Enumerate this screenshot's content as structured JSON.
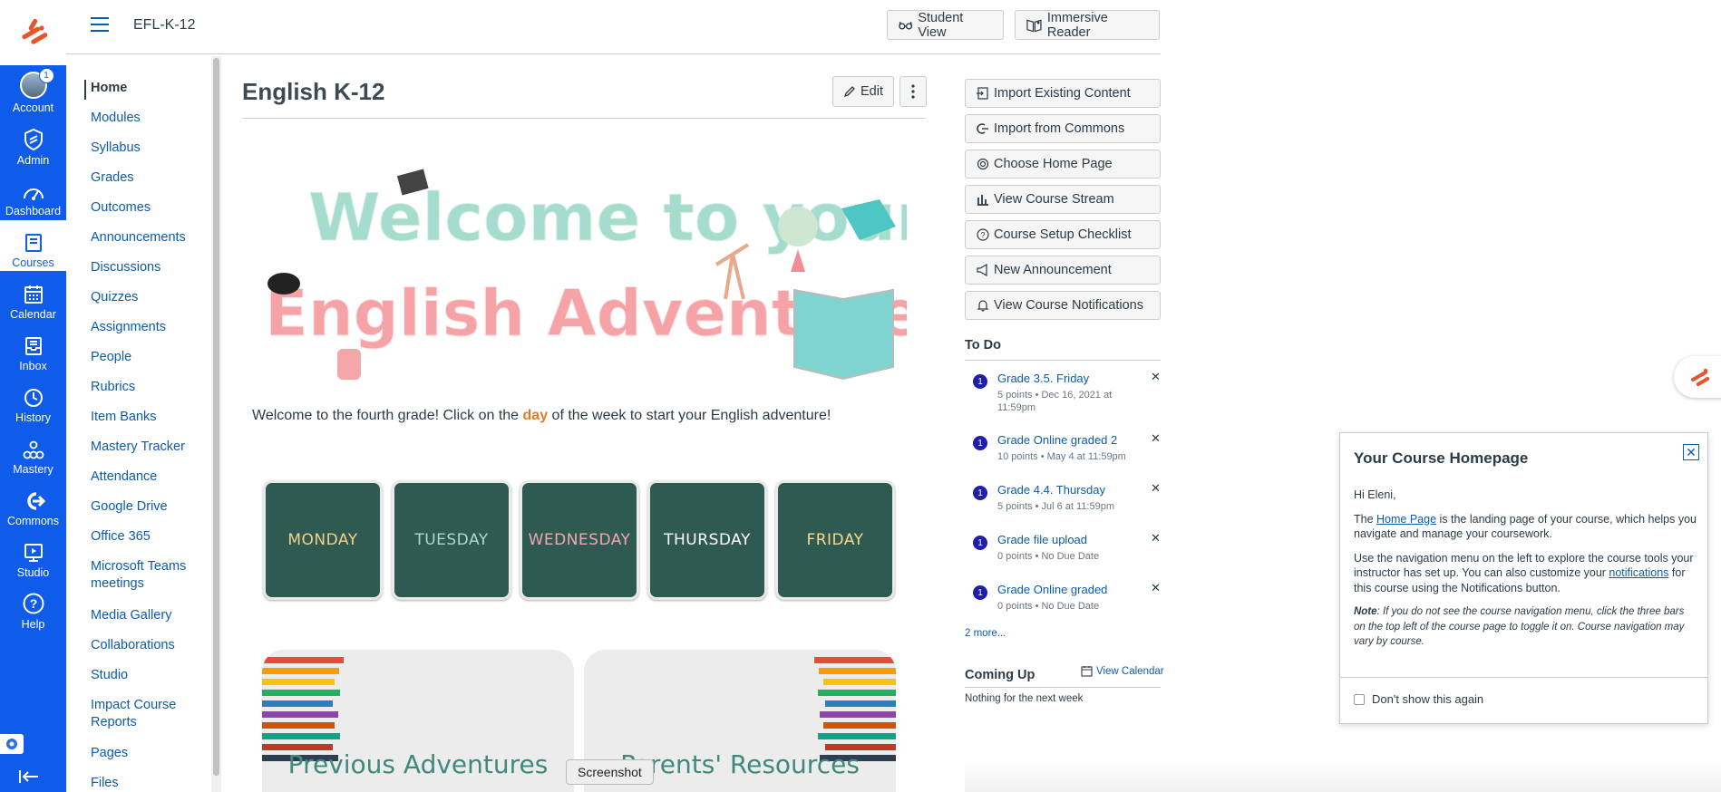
{
  "header": {
    "breadcrumb": "EFL-K-12",
    "student_view": "Student View",
    "immersive_reader": "Immersive Reader"
  },
  "global_nav": {
    "account_badge": "1",
    "items": [
      {
        "label": "Account",
        "icon": "avatar"
      },
      {
        "label": "Admin",
        "icon": "shield-icon"
      },
      {
        "label": "Dashboard",
        "icon": "dashboard-icon"
      },
      {
        "label": "Courses",
        "icon": "book-icon"
      },
      {
        "label": "Calendar",
        "icon": "calendar-icon"
      },
      {
        "label": "Inbox",
        "icon": "inbox-icon"
      },
      {
        "label": "History",
        "icon": "clock-icon"
      },
      {
        "label": "Mastery",
        "icon": "mastery-icon"
      },
      {
        "label": "Commons",
        "icon": "commons-icon"
      },
      {
        "label": "Studio",
        "icon": "studio-icon"
      },
      {
        "label": "Help",
        "icon": "help-icon"
      }
    ]
  },
  "course_nav": [
    "Home",
    "Modules",
    "Syllabus",
    "Grades",
    "Outcomes",
    "Announcements",
    "Discussions",
    "Quizzes",
    "Assignments",
    "People",
    "Rubrics",
    "Item Banks",
    "Mastery Tracker",
    "Attendance",
    "Google Drive",
    "Office 365",
    "Microsoft Teams meetings",
    "Media Gallery",
    "Collaborations",
    "Studio",
    "Impact Course Reports",
    "Pages",
    "Files"
  ],
  "main": {
    "title": "English K-12",
    "edit_label": "Edit",
    "banner_line1": "Welcome to your",
    "banner_line2": "English Adventure!",
    "intro_before": "Welcome to the fourth grade! Click on the ",
    "intro_day": "day",
    "intro_after": " of the week to start your English adventure!",
    "days": [
      {
        "label": "MONDAY",
        "color": "#f3d28a"
      },
      {
        "label": "TUESDAY",
        "color": "#a8d8d3"
      },
      {
        "label": "WEDNESDAY",
        "color": "#f2a6b4"
      },
      {
        "label": "THURSDAY",
        "color": "#ffffff"
      },
      {
        "label": "FRIDAY",
        "color": "#f9d98a"
      }
    ],
    "card_previous": "Previous Adventures",
    "card_parents": "Parents' Resources",
    "tooltip": "Screenshot"
  },
  "sidebar": {
    "buttons": [
      {
        "label": "Import Existing Content",
        "icon": "import-icon"
      },
      {
        "label": "Import from Commons",
        "icon": "commons-icon"
      },
      {
        "label": "Choose Home Page",
        "icon": "target-icon"
      },
      {
        "label": "View Course Stream",
        "icon": "bar-chart-icon"
      },
      {
        "label": "Course Setup Checklist",
        "icon": "question-icon"
      },
      {
        "label": "New Announcement",
        "icon": "megaphone-icon"
      },
      {
        "label": "View Course Notifications",
        "icon": "bell-icon"
      }
    ],
    "todo_heading": "To Do",
    "todos": [
      {
        "badge": "1",
        "title": "Grade 3.5. Friday",
        "meta": "5 points • Dec 16, 2021 at 11:59pm"
      },
      {
        "badge": "1",
        "title": "Grade Online graded 2",
        "meta": "10 points • May 4 at 11:59pm"
      },
      {
        "badge": "1",
        "title": "Grade 4.4. Thursday",
        "meta": "5 points • Jul 6 at 11:59pm"
      },
      {
        "badge": "1",
        "title": "Grade file upload",
        "meta": "0 points • No Due Date"
      },
      {
        "badge": "1",
        "title": "Grade Online graded",
        "meta": "0 points • No Due Date"
      }
    ],
    "more_link": "2 more...",
    "coming_up_heading": "Coming Up",
    "view_calendar": "View Calendar",
    "coming_up_text": "Nothing for the next week"
  },
  "popover": {
    "title": "Your Course Homepage",
    "greeting": "Hi Eleni,",
    "p1_before": "The ",
    "p1_link": "Home Page",
    "p1_after": " is the landing page of your course, which helps you navigate and manage your coursework.",
    "p2_before": "Use the navigation menu on the left to explore the course tools your instructor has set up. You can also customize your ",
    "p2_link": "notifications",
    "p2_after": " for this course using the Notifications button.",
    "note_label": "Note",
    "note_text": ": If you do not see the course navigation menu, click the three bars on the top left of the course page to toggle it on. Course navigation may vary by course.",
    "dont_show": "Don't show this again"
  },
  "colors": {
    "brand_blue": "#0f5bea",
    "link_blue": "#0b5cad",
    "chalkboard": "#2e5a52",
    "accent_orange": "#e07a27"
  }
}
